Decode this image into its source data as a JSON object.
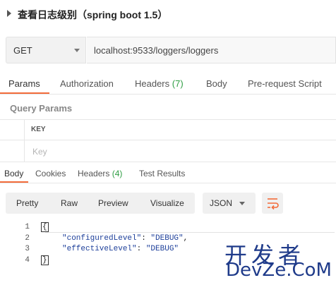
{
  "page_title": "查看日志级别（spring boot 1.5）",
  "request": {
    "method": "GET",
    "url": "localhost:9533/loggers/loggers"
  },
  "request_tabs": {
    "params": "Params",
    "authorization": "Authorization",
    "headers": "Headers",
    "headers_count": "(7)",
    "body": "Body",
    "prerequest": "Pre-request Script"
  },
  "query_params": {
    "label": "Query Params",
    "key_header": "KEY",
    "key_placeholder": "Key"
  },
  "response_tabs": {
    "body": "Body",
    "cookies": "Cookies",
    "headers": "Headers",
    "headers_count": "(4)",
    "test_results": "Test Results"
  },
  "view_modes": {
    "pretty": "Pretty",
    "raw": "Raw",
    "preview": "Preview",
    "visualize": "Visualize"
  },
  "format": {
    "selected": "JSON"
  },
  "response_body": {
    "line_numbers": [
      "1",
      "2",
      "3",
      "4"
    ],
    "open_brace": "{",
    "line2_key": "\"configuredLevel\"",
    "line2_sep": ": ",
    "line2_value": "\"DEBUG\"",
    "line2_comma": ",",
    "line3_key": "\"effectiveLevel\"",
    "line3_sep": ": ",
    "line3_value": "\"DEBUG\"",
    "close_brace": "}"
  },
  "watermark": {
    "line1": "开发者",
    "line2": "DevZe.CoM"
  },
  "colors": {
    "accent": "#f26b3a",
    "count_green": "#2f9e44",
    "watermark_blue": "#1f3b8a"
  }
}
